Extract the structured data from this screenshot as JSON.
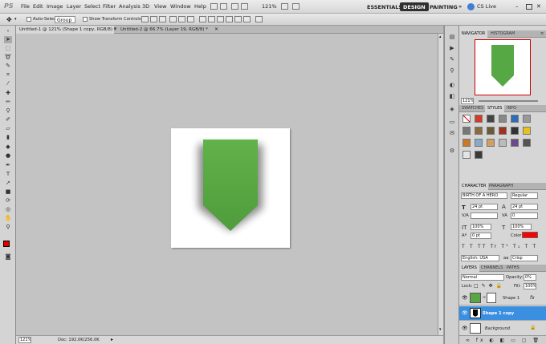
{
  "app": {
    "logo": "PS"
  },
  "menu": [
    "File",
    "Edit",
    "Image",
    "Layer",
    "Select",
    "Filter",
    "Analysis",
    "3D",
    "View",
    "Window",
    "Help"
  ],
  "zoom_menu": "121%",
  "workspaces": [
    "ESSENTIALS",
    "DESIGN",
    "PAINTING"
  ],
  "workspace_selected": "DESIGN",
  "cs_live": "CS Live",
  "options": {
    "auto_select": "Auto-Select:",
    "auto_select_value": "Group",
    "show_transform": "Show Transform Controls"
  },
  "tabs": [
    "Untitled-1 @ 121% (Shape 1 copy, RGB/8) *",
    "Untitled-2 @ 66.7% (Layer 19, RGB/8) *"
  ],
  "status": {
    "zoom": "121%",
    "doc": "Doc: 192.0K/256.0K"
  },
  "navigator": {
    "tabs": [
      "NAVIGATOR",
      "HISTOGRAM"
    ],
    "zoom": "121%"
  },
  "styles_panel": {
    "tabs": [
      "SWATCHES",
      "STYLES",
      "INFO"
    ]
  },
  "character": {
    "tabs": [
      "CHARACTER",
      "PARAGRAPH"
    ],
    "font": "BIRTH OF A HERO",
    "style": "Regular",
    "size": "24 pt",
    "leading": "24 pt",
    "kerning": "",
    "tracking": "0",
    "vscale": "100%",
    "hscale": "100%",
    "baseline": "0 pt",
    "color_label": "Color:",
    "language": "English: USA",
    "antialias": "Crisp",
    "colors": {
      "text": "#ff0000"
    }
  },
  "layers": {
    "tabs": [
      "LAYERS",
      "CHANNELS",
      "PATHS"
    ],
    "blend": "Normal",
    "opacity_label": "Opacity:",
    "opacity": "0%",
    "lock_label": "Lock:",
    "fill_label": "Fill:",
    "fill": "100%",
    "items": [
      {
        "name": "Shape 1",
        "selected": false
      },
      {
        "name": "Shape 1 copy",
        "selected": true
      },
      {
        "name": "Background",
        "selected": false
      }
    ]
  },
  "colors": {
    "accent": "#5aa545",
    "selected_layer": "#3b8fe0",
    "workspace_dark": "#2f2f2f"
  }
}
